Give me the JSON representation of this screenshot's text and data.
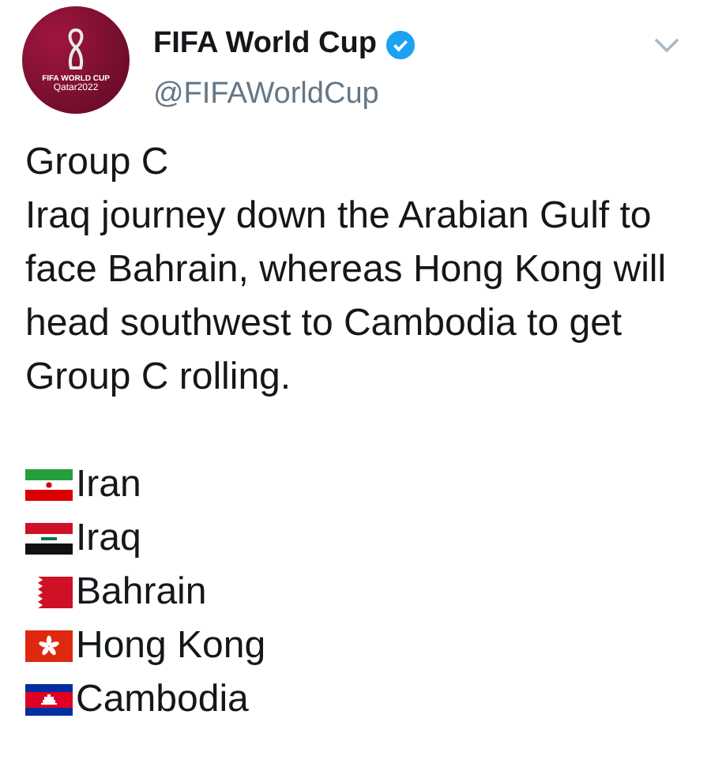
{
  "account": {
    "avatar": {
      "line_1": "FIFA WORLD CUP",
      "line_2": "Qatar2022"
    },
    "name": "FIFA World Cup",
    "verified": true,
    "handle": "@FIFAWorldCup"
  },
  "tweet": {
    "title": "Group C",
    "text": "Iraq journey down the Arabian Gulf to face Bahrain, whereas Hong Kong will head southwest to Cambodia to get Group C rolling.",
    "teams": [
      {
        "kind": "iran",
        "name": "Iran"
      },
      {
        "kind": "iraq",
        "name": "Iraq"
      },
      {
        "kind": "bahrain",
        "name": "Bahrain"
      },
      {
        "kind": "hongkong",
        "name": "Hong Kong"
      },
      {
        "kind": "cambodia",
        "name": "Cambodia"
      }
    ]
  }
}
